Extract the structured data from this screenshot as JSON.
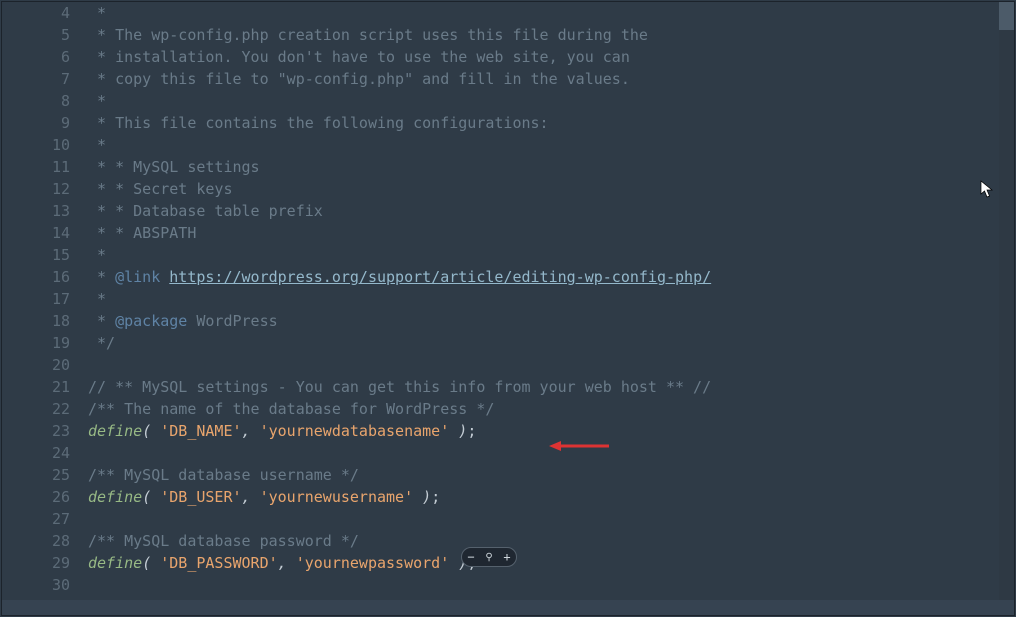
{
  "syntax": {
    "define": "define",
    "p_open": "( ",
    "p_close": " )",
    "semi": ";",
    "comma": ", "
  },
  "zoom": {
    "minus": "−",
    "plus": "+",
    "mag": "⚲"
  },
  "lines": [
    {
      "n": "4",
      "parts": [
        {
          "c": "c-comment",
          "t": " *"
        }
      ]
    },
    {
      "n": "5",
      "parts": [
        {
          "c": "c-comment",
          "t": " * The wp-config.php creation script uses this file during the"
        }
      ]
    },
    {
      "n": "6",
      "parts": [
        {
          "c": "c-comment",
          "t": " * installation. You don't have to use the web site, you can"
        }
      ]
    },
    {
      "n": "7",
      "parts": [
        {
          "c": "c-comment",
          "t": " * copy this file to \"wp-config.php\" and fill in the values."
        }
      ]
    },
    {
      "n": "8",
      "parts": [
        {
          "c": "c-comment",
          "t": " *"
        }
      ]
    },
    {
      "n": "9",
      "parts": [
        {
          "c": "c-comment",
          "t": " * This file contains the following configurations:"
        }
      ]
    },
    {
      "n": "10",
      "parts": [
        {
          "c": "c-comment",
          "t": " *"
        }
      ]
    },
    {
      "n": "11",
      "parts": [
        {
          "c": "c-comment",
          "t": " * * MySQL settings"
        }
      ]
    },
    {
      "n": "12",
      "parts": [
        {
          "c": "c-comment",
          "t": " * * Secret keys"
        }
      ]
    },
    {
      "n": "13",
      "parts": [
        {
          "c": "c-comment",
          "t": " * * Database table prefix"
        }
      ]
    },
    {
      "n": "14",
      "parts": [
        {
          "c": "c-comment",
          "t": " * * ABSPATH"
        }
      ]
    },
    {
      "n": "15",
      "parts": [
        {
          "c": "c-comment",
          "t": " *"
        }
      ]
    },
    {
      "n": "16",
      "parts": [
        {
          "c": "c-comment",
          "t": " * "
        },
        {
          "c": "c-tag",
          "t": "@link"
        },
        {
          "c": "c-comment",
          "t": " "
        },
        {
          "c": "c-link",
          "t": "https://wordpress.org/support/article/editing-wp-config-php/"
        }
      ]
    },
    {
      "n": "17",
      "parts": [
        {
          "c": "c-comment",
          "t": " *"
        }
      ]
    },
    {
      "n": "18",
      "parts": [
        {
          "c": "c-comment",
          "t": " * "
        },
        {
          "c": "c-tag",
          "t": "@package"
        },
        {
          "c": "c-comment",
          "t": " WordPress"
        }
      ]
    },
    {
      "n": "19",
      "parts": [
        {
          "c": "c-comment",
          "t": " */"
        }
      ]
    },
    {
      "n": "20",
      "parts": []
    },
    {
      "n": "21",
      "parts": [
        {
          "c": "c-comment",
          "t": "// ** MySQL settings - You can get this info from your web host ** //"
        }
      ]
    },
    {
      "n": "22",
      "parts": [
        {
          "c": "c-comment",
          "t": "/** The name of the database for WordPress */"
        }
      ]
    },
    {
      "n": "23",
      "define": {
        "k": "'DB_NAME'",
        "v": "'yournewdatabasename'"
      }
    },
    {
      "n": "24",
      "parts": []
    },
    {
      "n": "25",
      "parts": [
        {
          "c": "c-comment",
          "t": "/** MySQL database username */"
        }
      ]
    },
    {
      "n": "26",
      "define": {
        "k": "'DB_USER'",
        "v": "'yournewusername'"
      }
    },
    {
      "n": "27",
      "parts": []
    },
    {
      "n": "28",
      "parts": [
        {
          "c": "c-comment",
          "t": "/** MySQL database password */"
        }
      ]
    },
    {
      "n": "29",
      "define": {
        "k": "'DB_PASSWORD'",
        "v": "'yournewpassword'"
      }
    },
    {
      "n": "30",
      "parts": []
    }
  ]
}
